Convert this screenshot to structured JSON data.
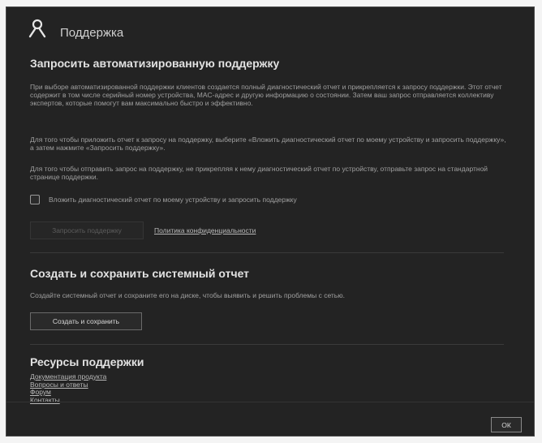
{
  "header": {
    "title": "Поддержка",
    "icon": "user-support-icon"
  },
  "section_auto": {
    "title": "Запросить автоматизированную поддержку",
    "paragraph1": "При выборе автоматизированной поддержки клиентов создается полный диагностический отчет и прикрепляется к запросу поддержки. Этот отчет содержит в том числе серийный номер устройства, MAC-адрес и другую информацию о состоянии. Затем ваш запрос отправляется коллективу экспертов, которые помогут вам максимально быстро и эффективно.",
    "paragraph2": "Для того чтобы приложить отчет к запросу на поддержку, выберите «Вложить диагностический отчет по моему устройству и запросить поддержку», а затем нажмите «Запросить поддержку».",
    "paragraph3": "Для того чтобы отправить запрос на поддержку, не прикрепляя к нему диагностический отчет по устройству, отправьте запрос на стандартной странице поддержки.",
    "checkbox_label": "Вложить диагностический отчет по моему устройству и запросить поддержку",
    "checkbox_checked": false,
    "request_button": "Запросить поддержку",
    "privacy_link": "Политика конфиденциальности"
  },
  "section_report": {
    "title": "Создать и сохранить системный отчет",
    "description": "Создайте системный отчет и сохраните его на диске, чтобы выявить и решить проблемы с сетью.",
    "create_button": "Создать и сохранить"
  },
  "section_resources": {
    "title": "Ресурсы поддержки",
    "links": [
      "Документация продукта",
      "Вопросы и ответы",
      "Форум",
      "Контакты"
    ]
  },
  "footer": {
    "ok_button": "ОК"
  },
  "colors": {
    "background": "#232323",
    "text": "#a0a0a0",
    "heading": "#e2e2e2"
  }
}
